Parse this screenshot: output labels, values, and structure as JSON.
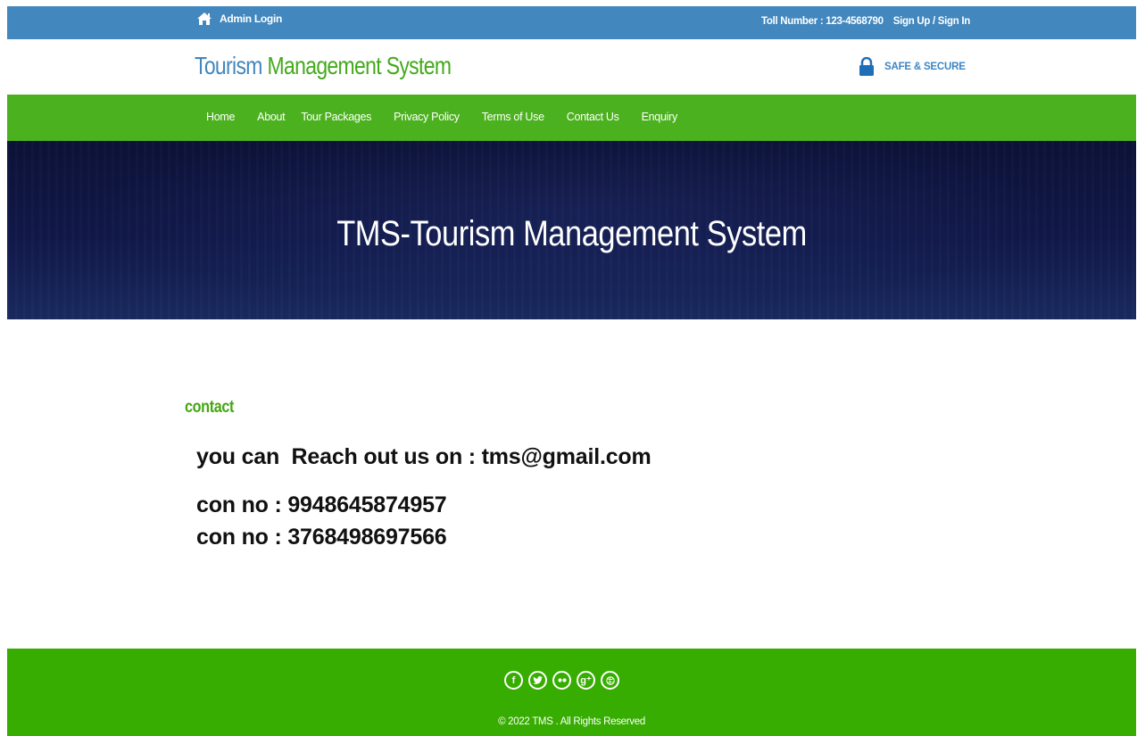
{
  "topbar": {
    "admin_login": "Admin Login",
    "toll_number": "Toll Number : 123-4568790",
    "signup_signin": "Sign Up / Sign In"
  },
  "header": {
    "logo_part1": "Tourism",
    "logo_part2": "Management System",
    "secure_label": "SAFE & SECURE"
  },
  "nav": {
    "items": [
      {
        "label": "Home"
      },
      {
        "label": "About"
      },
      {
        "label": "Tour Packages"
      },
      {
        "label": "Privacy Policy"
      },
      {
        "label": "Terms of Use"
      },
      {
        "label": "Contact Us"
      },
      {
        "label": "Enquiry"
      }
    ]
  },
  "banner": {
    "title": "TMS-Tourism Management System"
  },
  "content": {
    "section_tag": "contact",
    "reach_text": "you can  Reach out us on : tms@gmail.com",
    "phone1": "con no : 9948645874957",
    "phone2": "con no : 3768498697566"
  },
  "footer": {
    "social_icons": [
      "facebook-icon",
      "twitter-icon",
      "flickr-icon",
      "google-plus-icon",
      "dribbble-icon"
    ],
    "copyright": "© 2022 TMS . All Rights Reserved"
  },
  "colors": {
    "topbar_blue": "#4287bd",
    "nav_green": "#4cb11f",
    "footer_green": "#36ad00",
    "logo_blue": "#4287bd",
    "logo_green": "#43aa1b",
    "banner_navy": "#11194a"
  }
}
